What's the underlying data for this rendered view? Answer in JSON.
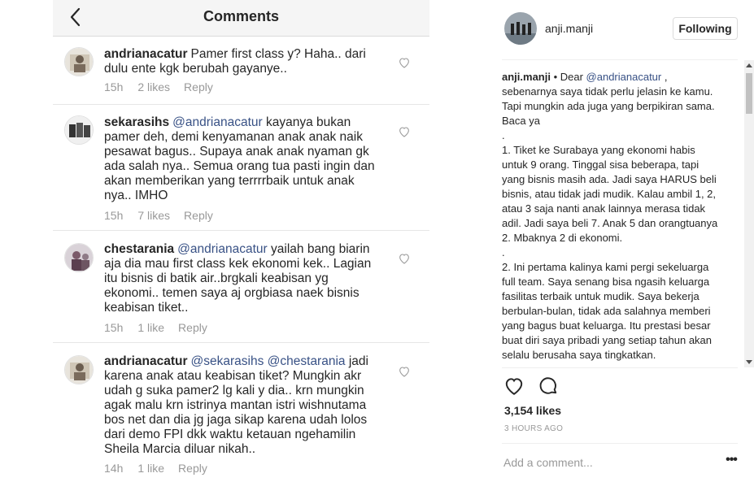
{
  "comments_panel": {
    "title": "Comments",
    "back_icon": "chevron-left-icon",
    "comments": [
      {
        "username": "andrianacatur",
        "mentions": [],
        "text": "Pamer first class y? Haha.. dari dulu ente kgk berubah gayanye..",
        "time": "15h",
        "likes": "2 likes",
        "reply_label": "Reply"
      },
      {
        "username": "sekarasihs",
        "mentions": [
          "@andrianacatur"
        ],
        "text": "kayanya bukan pamer deh, demi kenyamanan anak anak naik pesawat bagus.. Supaya anak anak nyaman gk ada salah nya.. Semua orang tua pasti ingin dan akan memberikan yang terrrrbaik untuk anak nya.. IMHO",
        "time": "15h",
        "likes": "7 likes",
        "reply_label": "Reply"
      },
      {
        "username": "chestarania",
        "mentions": [
          "@andrianacatur"
        ],
        "text": "yailah bang biarin aja dia mau first class kek ekonomi kek.. Lagian itu bisnis di batik air..brgkali keabisan yg ekonomi.. temen saya aj orgbiasa naek bisnis keabisan tiket..",
        "time": "15h",
        "likes": "1 like",
        "reply_label": "Reply"
      },
      {
        "username": "andrianacatur",
        "mentions": [
          "@sekarasihs",
          "@chestarania"
        ],
        "text": "jadi karena anak atau keabisan tiket? Mungkin akr udah g suka pamer2 lg kali y dia.. krn mungkin agak malu krn istrinya mantan istri wishnutama bos net dan dia jg jaga sikap karena udah lolos dari demo FPI dkk waktu ketauan ngehamilin Sheila Marcia diluar nikah..",
        "time": "14h",
        "likes": "1 like",
        "reply_label": "Reply"
      }
    ]
  },
  "post_panel": {
    "username": "anji.manji",
    "follow_button": "Following",
    "caption": {
      "username": "anji.manji",
      "separator": " • ",
      "intro": "Dear ",
      "mention": "@andrianacatur",
      "body": " , sebenarnya saya tidak perlu jelasin ke kamu. Tapi mungkin ada juga yang berpikiran sama. Baca ya\n.\n1. Tiket ke Surabaya yang ekonomi habis untuk 9 orang. Tinggal sisa beberapa, tapi yang bisnis masih ada. Jadi saya HARUS beli bisnis, atau tidak jadi mudik. Kalau ambil 1, 2, atau 3 saja nanti anak lainnya merasa tidak adil. Jadi saya beli 7. Anak 5 dan orangtuanya 2. Mbaknya 2 di ekonomi.\n.\n2. Ini pertama kalinya kami pergi sekeluarga full team. Saya senang bisa ngasih keluarga fasilitas terbaik untuk mudik. Saya bekerja berbulan-bulan, tidak ada salahnya memberi yang bagus buat keluarga. Itu prestasi besar buat diri saya pribadi yang setiap tahun akan selalu berusaha saya tingkatkan."
    },
    "likes": "3,154 likes",
    "timestamp": "3 HOURS AGO",
    "comment_placeholder": "Add a comment...",
    "more_label": "•••",
    "icons": {
      "like": "heart-icon",
      "comment": "comment-bubble-icon",
      "more": "more-options-icon"
    }
  },
  "colors": {
    "text": "#262626",
    "muted": "#999999",
    "mention": "#385185",
    "border": "#dbdbdb",
    "header_bg": "#f5f5f5"
  }
}
